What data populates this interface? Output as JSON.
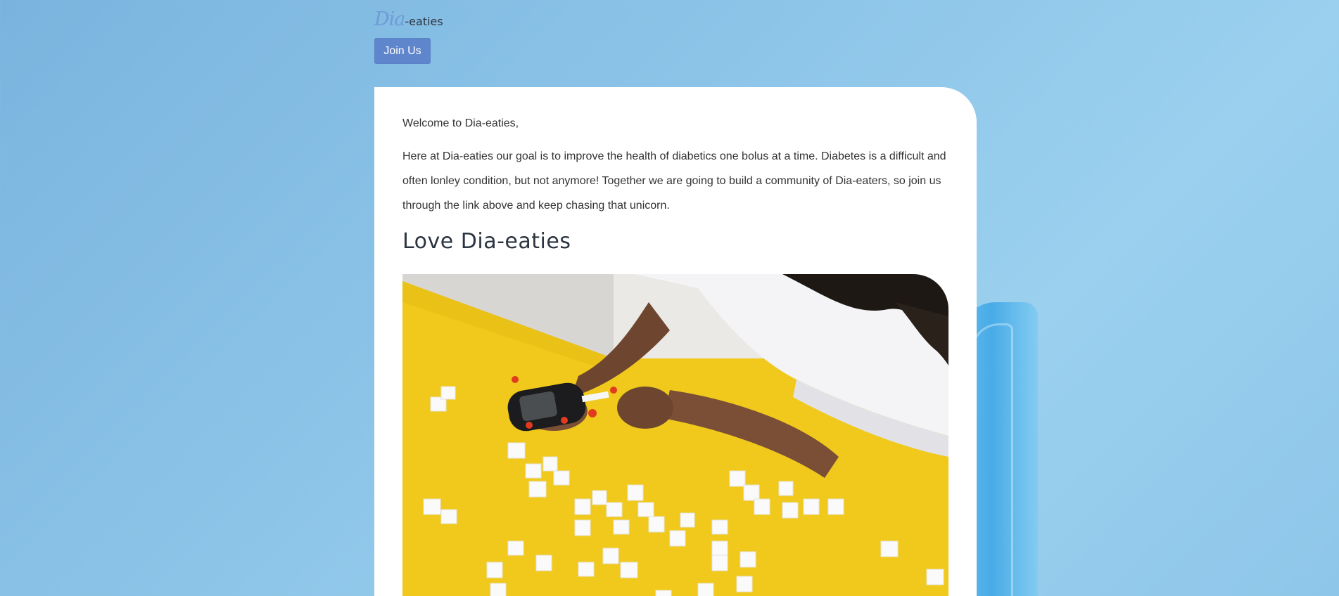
{
  "header": {
    "logo_mark": "Dia",
    "logo_text": "-eaties",
    "join_label": "Join Us"
  },
  "content": {
    "welcome": "Welcome to Dia-eaties,",
    "intro": "Here at Dia-eaties our goal is to improve the health of diabetics one bolus at a time. Diabetes is a difficult and often lonley condition, but not anymore! Together we are going to build a community of Dia-eaters, so join us through the link above and keep chasing that unicorn.",
    "heading": "Love Dia-eaties"
  },
  "colors": {
    "background": "#8cc4e8",
    "button": "#5f86cc",
    "logo_accent": "#6f9ad6",
    "card": "#ffffff",
    "table_yellow": "#f2cd1f"
  }
}
